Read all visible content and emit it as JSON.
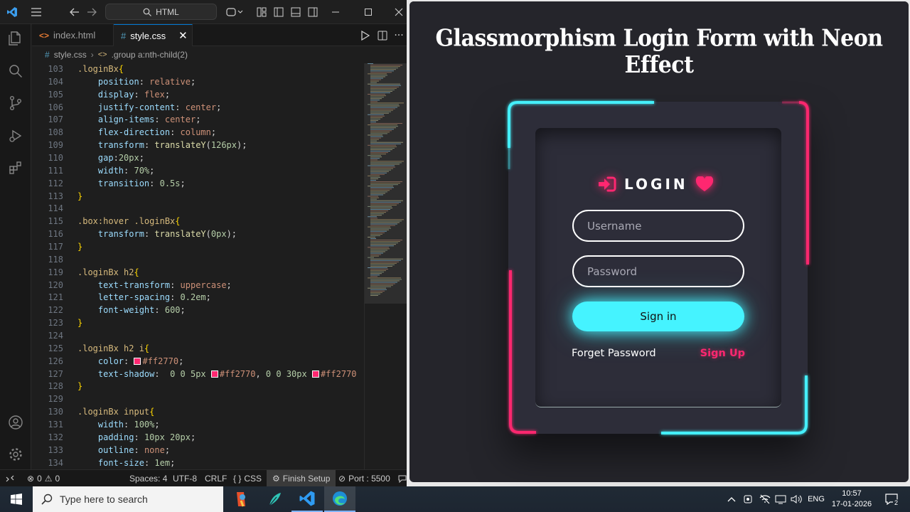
{
  "titlebar": {
    "search_label": "HTML"
  },
  "tabs": [
    {
      "label": "index.html",
      "icon": "html-file-icon"
    },
    {
      "label": "style.css",
      "icon": "css-file-icon"
    }
  ],
  "breadcrumb": {
    "file": "style.css",
    "symbol": ".group a:nth-child(2)"
  },
  "editor": {
    "line_numbers": [
      "103",
      "104",
      "105",
      "106",
      "107",
      "108",
      "109",
      "110",
      "111",
      "112",
      "113",
      "114",
      "115",
      "116",
      "117",
      "118",
      "119",
      "120",
      "121",
      "122",
      "123",
      "124",
      "125",
      "126",
      "127",
      "128",
      "129",
      "130",
      "131",
      "132",
      "133",
      "134"
    ]
  },
  "statusbar": {
    "errors": "0",
    "warnings": "0",
    "spaces": "Spaces: 4",
    "encoding": "UTF-8",
    "eol": "CRLF",
    "language": "CSS",
    "finish_setup": "Finish Setup",
    "port": "Port : 5500"
  },
  "preview": {
    "banner_title": "Glassmorphism Login Form with Neon Effect",
    "login_title": "LOGIN",
    "username_placeholder": "Username",
    "password_placeholder": "Password",
    "signin_label": "Sign in",
    "forget_label": "Forget Password",
    "signup_label": "Sign Up",
    "colors": {
      "cyan": "#45f3ff",
      "pink": "#ff2770",
      "bg": "#25252b",
      "box": "#2d2d39"
    }
  },
  "taskbar": {
    "search_placeholder": "Type here to search",
    "language": "ENG",
    "time": "10:57",
    "date": "17-01-2026",
    "notification_count": "2"
  }
}
